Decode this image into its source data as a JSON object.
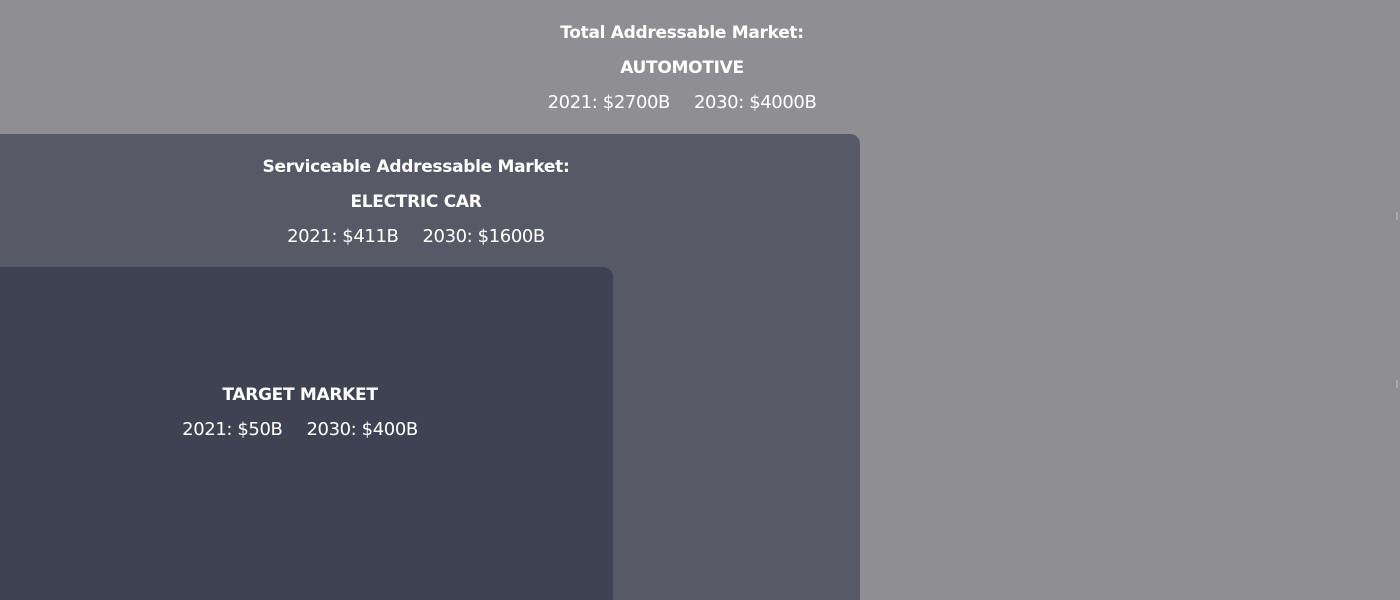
{
  "tam": {
    "title": "Total Addressable Market:",
    "segment": "AUTOMOTIVE",
    "value_2021": "2021: $2700B",
    "value_2030": "2030: $4000B"
  },
  "sam": {
    "title": "Serviceable Addressable Market:",
    "segment": "ELECTRIC CAR",
    "value_2021": "2021: $411B",
    "value_2030": "2030: $1600B"
  },
  "target": {
    "segment": "TARGET MARKET",
    "value_2021": "2021: $50B",
    "value_2030": "2030: $400B"
  },
  "colors": {
    "background": "#8e8e93",
    "sam_box": "#575a66",
    "target_box": "#3f4253",
    "text": "#ffffff"
  }
}
